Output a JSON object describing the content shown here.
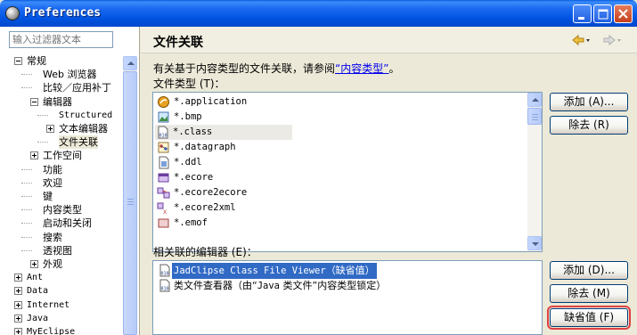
{
  "window": {
    "title": "Preferences"
  },
  "filter": {
    "placeholder": "输入过滤器文本"
  },
  "tree": [
    {
      "label": "常规",
      "depth": 0,
      "expander": "minus",
      "mono": false
    },
    {
      "label": "Web 浏览器",
      "depth": 1,
      "expander": "none",
      "mono": false
    },
    {
      "label": "比较／应用补丁",
      "depth": 1,
      "expander": "none",
      "mono": false
    },
    {
      "label": "编辑器",
      "depth": 1,
      "expander": "minus",
      "mono": false
    },
    {
      "label": "Structured",
      "depth": 2,
      "expander": "none",
      "mono": true
    },
    {
      "label": "文本编辑器",
      "depth": 2,
      "expander": "plus",
      "mono": false
    },
    {
      "label": "文件关联",
      "depth": 2,
      "expander": "none",
      "mono": false,
      "selected": true
    },
    {
      "label": "工作空间",
      "depth": 1,
      "expander": "plus",
      "mono": false
    },
    {
      "label": "功能",
      "depth": 1,
      "expander": "none",
      "mono": false
    },
    {
      "label": "欢迎",
      "depth": 1,
      "expander": "none",
      "mono": false
    },
    {
      "label": "键",
      "depth": 1,
      "expander": "none",
      "mono": false
    },
    {
      "label": "内容类型",
      "depth": 1,
      "expander": "none",
      "mono": false
    },
    {
      "label": "启动和关闭",
      "depth": 1,
      "expander": "none",
      "mono": false
    },
    {
      "label": "搜索",
      "depth": 1,
      "expander": "none",
      "mono": false
    },
    {
      "label": "透视图",
      "depth": 1,
      "expander": "none",
      "mono": false
    },
    {
      "label": "外观",
      "depth": 1,
      "expander": "plus",
      "mono": false
    },
    {
      "label": "Ant",
      "depth": 0,
      "expander": "plus",
      "mono": true
    },
    {
      "label": "Data",
      "depth": 0,
      "expander": "plus",
      "mono": true
    },
    {
      "label": "Internet",
      "depth": 0,
      "expander": "plus",
      "mono": true
    },
    {
      "label": "Java",
      "depth": 0,
      "expander": "plus",
      "mono": true
    },
    {
      "label": "MyEclipse",
      "depth": 0,
      "expander": "plus",
      "mono": true
    }
  ],
  "page": {
    "title": "文件关联",
    "description_prefix": "有关基于内容类型的文件关联，请参阅",
    "description_link": "“内容类型”",
    "description_suffix": "。",
    "file_types_label": "文件类型 (T)：",
    "editors_label": "相关联的编辑器 (E)："
  },
  "file_types": [
    {
      "name": "*.application",
      "icon": "java-app-icon"
    },
    {
      "name": "*.bmp",
      "icon": "image-icon"
    },
    {
      "name": "*.class",
      "icon": "class-file-icon",
      "selected": true
    },
    {
      "name": "*.datagraph",
      "icon": "datagraph-icon"
    },
    {
      "name": "*.ddl",
      "icon": "ddl-file-icon"
    },
    {
      "name": "*.ecore",
      "icon": "ecore-icon"
    },
    {
      "name": "*.ecore2ecore",
      "icon": "ecore-map-icon"
    },
    {
      "name": "*.ecore2xml",
      "icon": "ecore-xml-icon"
    },
    {
      "name": "*.emof",
      "icon": "emof-icon"
    }
  ],
  "editors": [
    {
      "prefix": "",
      "name_mono": "JadClipse Class File Viewer",
      "suffix": "（缺省值）",
      "icon": "class-file-icon",
      "selected": true
    },
    {
      "prefix": "类文件查看器（由“",
      "name_mono": "Java",
      "suffix": " 类文件”内容类型锁定）",
      "icon": "class-file-icon",
      "selected": false
    }
  ],
  "buttons": {
    "add_type": "添加 (A)...",
    "remove_type": "除去 (R)",
    "add_editor": "添加 (D)...",
    "remove_editor": "除去 (M)",
    "default": "缺省值 (F)"
  },
  "colors": {
    "titlebar": "#0054e3",
    "selection": "#316ac5",
    "link": "#0000ee",
    "focus_outline": "#e04040"
  }
}
